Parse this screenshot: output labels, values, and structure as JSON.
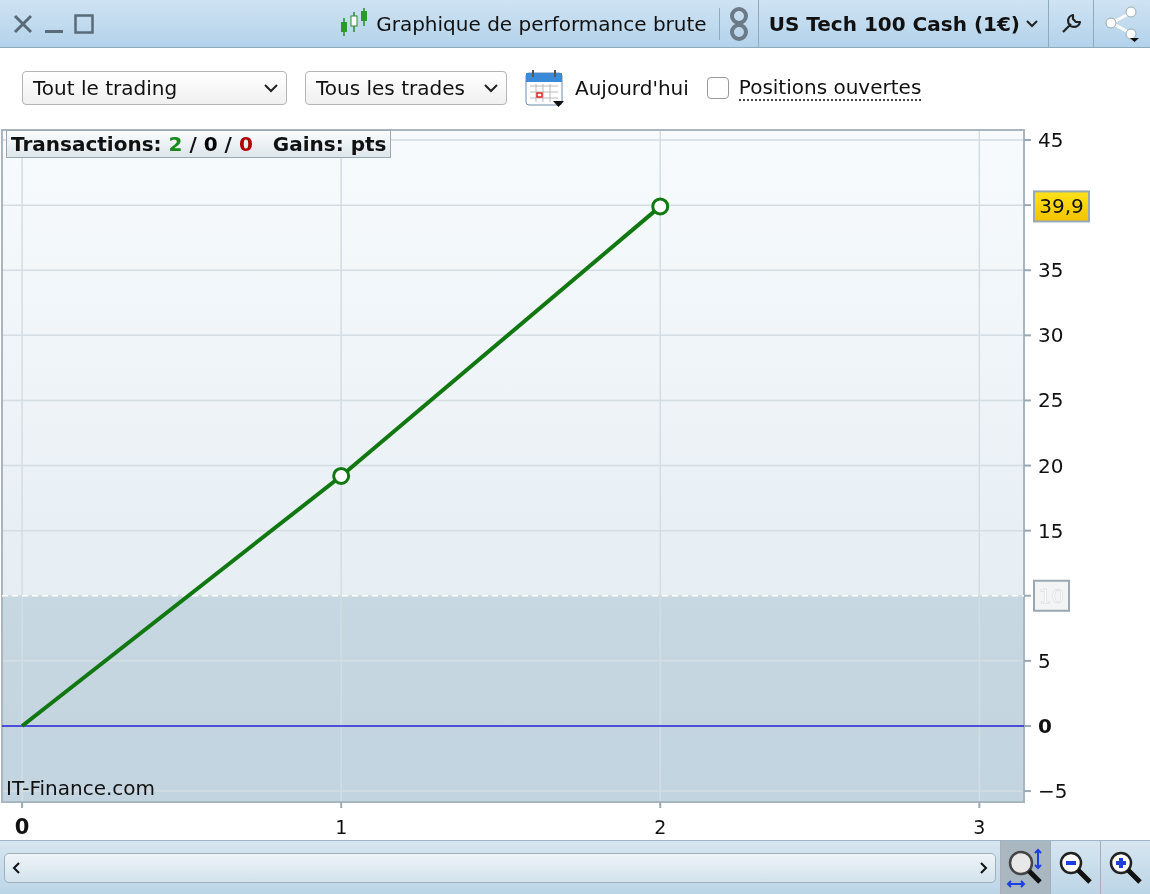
{
  "window": {
    "title": "Graphique de performance brute"
  },
  "instrument": {
    "label": "US Tech 100 Cash (1€)"
  },
  "toolbar": {
    "scope_select": {
      "value": "Tout le trading"
    },
    "trades_select": {
      "value": "Tous les trades"
    },
    "date_button": {
      "label": "Aujourd'hui"
    },
    "open_positions": {
      "label": "Positions ouvertes",
      "checked": false
    }
  },
  "summary": {
    "transactions_label": "Transactions:",
    "separator": "/",
    "counts": [
      {
        "value": "2",
        "color": "#1a8a1a"
      },
      {
        "value": "0",
        "color": "#000000"
      },
      {
        "value": "0",
        "color": "#b00000"
      }
    ],
    "gains_label": "Gains:",
    "gains_unit": "pts"
  },
  "branding": "IT-Finance.com",
  "chart_data": {
    "type": "line",
    "xlim": [
      -0.063,
      3.14
    ],
    "ylim": [
      -5.84,
      45.77
    ],
    "xticks": [
      0,
      1,
      2,
      3
    ],
    "yticks": [
      -5,
      0,
      5,
      10,
      15,
      20,
      25,
      30,
      35,
      45
    ],
    "grid": true,
    "series": [
      {
        "color": "#117711",
        "values": [
          0,
          19.2,
          39.9
        ]
      }
    ],
    "x": [
      0,
      1,
      2
    ],
    "ref_lines": [
      {
        "axis": "y",
        "value": 0,
        "color": "#2020d0"
      },
      {
        "axis": "y",
        "value": 10,
        "label": "10",
        "color": "#ffffff"
      }
    ],
    "bands": [
      {
        "axis": "y",
        "from": -5.84,
        "to": 10,
        "color": "#9fbccd"
      }
    ],
    "annotations": [
      "39,9"
    ]
  },
  "zoom_tools": [
    {
      "kind": "fit",
      "selected": true
    },
    {
      "kind": "zoom_out",
      "selected": false
    },
    {
      "kind": "zoom_in",
      "selected": false
    }
  ]
}
